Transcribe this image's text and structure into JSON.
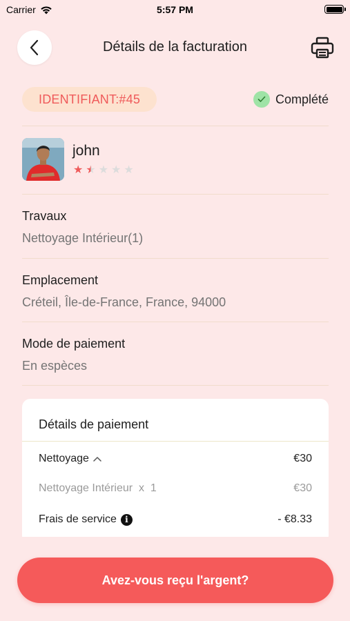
{
  "status_bar": {
    "carrier": "Carrier",
    "time": "5:57 PM"
  },
  "header": {
    "title": "Détails de la facturation",
    "back_icon": "chevron-left-icon",
    "print_icon": "printer-icon"
  },
  "order": {
    "id_label": "IDENTIFIANT:#45",
    "status": "Complété"
  },
  "user": {
    "name": "john",
    "rating": 1.5,
    "max_rating": 5
  },
  "details": [
    {
      "label": "Travaux",
      "value": "Nettoyage Intérieur(1)"
    },
    {
      "label": "Emplacement",
      "value": "Créteil, Île-de-France, France, 94000"
    },
    {
      "label": "Mode de paiement",
      "value": "En espèces"
    }
  ],
  "payment": {
    "title": "Détails de paiement",
    "lines": [
      {
        "label": "Nettoyage",
        "amount": "€30"
      },
      {
        "label": "Nettoyage Intérieur  x  1",
        "amount": "€30"
      },
      {
        "label": "Frais de service",
        "amount": "- €8.33"
      }
    ]
  },
  "cta_label": "Avez-vous reçu l'argent?",
  "colors": {
    "background": "#fde8e8",
    "accent": "#f55a5a",
    "badge_bg": "#fde2cf",
    "success": "#9fe3a6"
  }
}
